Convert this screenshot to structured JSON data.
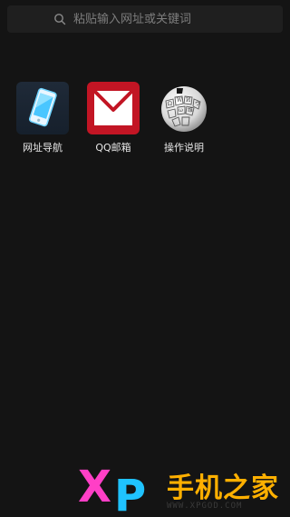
{
  "search": {
    "placeholder": "粘贴输入网址或关键词",
    "icon": "search-icon"
  },
  "shortcuts": [
    {
      "label": "网址导航",
      "icon": "phone-icon"
    },
    {
      "label": "QQ邮箱",
      "icon": "mail-icon"
    },
    {
      "label": "操作说明",
      "icon": "wikipedia-globe-icon"
    }
  ],
  "watermark": {
    "logo_x": "X",
    "logo_p": "P",
    "text": "手机之家",
    "url": "WWW.XPGOD.COM"
  },
  "colors": {
    "background": "#141414",
    "search_background": "#1f1f1f",
    "mail_red": "#c21524",
    "watermark_pink": "#ff3fc6",
    "watermark_blue": "#1fc3ff",
    "watermark_orange": "#ffb000"
  }
}
